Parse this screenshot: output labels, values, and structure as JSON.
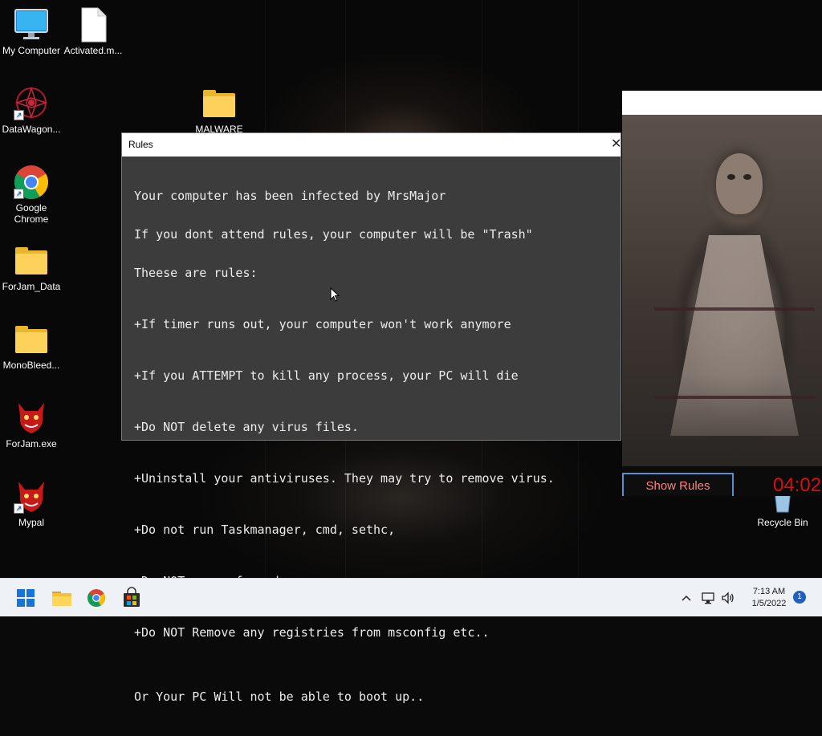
{
  "desktop": {
    "icons": [
      {
        "label": "My Computer",
        "icon": "monitor-icon"
      },
      {
        "label": "Activated.m...",
        "icon": "file-icon"
      },
      {
        "label": "DataWagon...",
        "icon": "datawagon-icon"
      },
      {
        "label": "MALWARE",
        "icon": "folder-icon"
      },
      {
        "label": "Google Chrome",
        "icon": "chrome-icon"
      },
      {
        "label": "ForJam_Data",
        "icon": "folder-icon"
      },
      {
        "label": "MonoBleed...",
        "icon": "folder-icon"
      },
      {
        "label": "ForJam.exe",
        "icon": "red-demon-icon"
      },
      {
        "label": "Mypal",
        "icon": "red-demon-icon"
      },
      {
        "label": "Recycle Bin",
        "icon": "recycle-bin-icon"
      }
    ]
  },
  "rules_window": {
    "title": "Rules",
    "close_glyph": "✕",
    "intro": [
      "Your computer has been infected by MrsMajor",
      "If you dont attend rules, your computer will be \"Trash\"",
      "Theese are rules:"
    ],
    "rules": [
      "+If timer runs out, your computer won't work anymore",
      "+If you ATTEMPT to kill any process, your PC will die",
      "+Do NOT delete any virus files.",
      "+Uninstall your antiviruses. They may try to remove virus.",
      "+Do not run Taskmanager, cmd, sethc,",
      "+Do NOT use safe mode.",
      "+Do NOT Remove any registries from msconfig etc.."
    ],
    "footer": "Or Your PC Will not be able to boot up.."
  },
  "ransom_window": {
    "show_rules_label": "Show Rules",
    "timer": "04:02",
    "accent_color": "#d41010"
  },
  "taskbar": {
    "time": "7:13 AM",
    "date": "1/5/2022",
    "notification_count": "1",
    "pinned": [
      "start-icon",
      "file-explorer-icon",
      "chrome-icon",
      "store-icon"
    ]
  }
}
